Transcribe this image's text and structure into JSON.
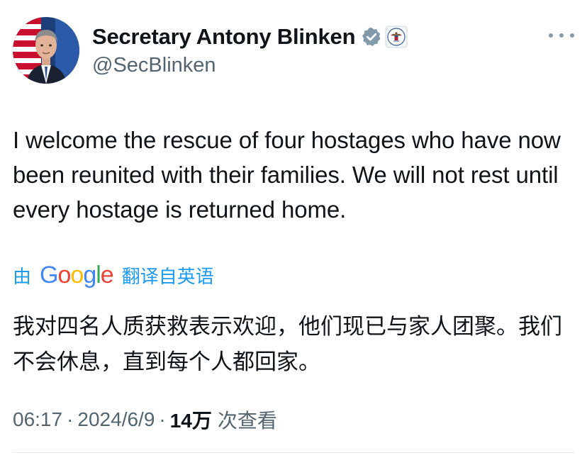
{
  "author": {
    "display_name": "Secretary Antony Blinken",
    "handle": "@SecBlinken",
    "verified_badge_color": "#829aab"
  },
  "tweet": {
    "text": "I welcome the rescue of four hostages who have now been reunited with their families. We will not rest until every hostage is returned home."
  },
  "translation": {
    "by_label": "由",
    "provider": "Google",
    "action_label": "翻译自英语",
    "translated_text": "我对四名人质获救表示欢迎，他们现已与家人团聚。我们不会休息，直到每个人都回家。"
  },
  "meta": {
    "time": "06:17",
    "separator": "·",
    "date": "2024/6/9",
    "views_count": "14万",
    "views_label": "次查看"
  },
  "colors": {
    "link_blue": "#1d9bf0",
    "secondary_text": "#536471",
    "primary_text": "#0f1419"
  },
  "icons": {
    "verified": "verified-badge-icon",
    "affiliation": "us-state-department-seal-icon",
    "more": "more-options-icon"
  }
}
